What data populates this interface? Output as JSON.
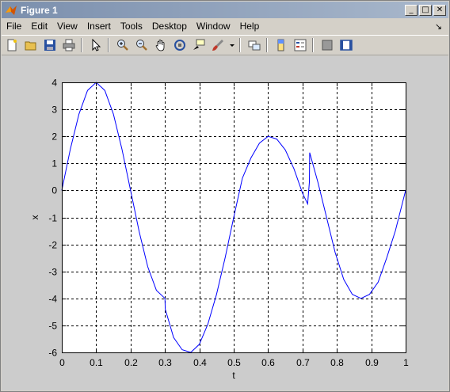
{
  "window": {
    "title": "Figure 1",
    "buttons": {
      "minimize": "_",
      "maximize": "□",
      "close": "✕"
    }
  },
  "menu": {
    "items": [
      "File",
      "Edit",
      "View",
      "Insert",
      "Tools",
      "Desktop",
      "Window",
      "Help"
    ],
    "dock_arrow": "↘"
  },
  "toolbar": {
    "icons": [
      "new-figure-icon",
      "open-file-icon",
      "save-icon",
      "print-icon",
      "arrow-pointer-icon",
      "zoom-in-icon",
      "zoom-out-icon",
      "pan-hand-icon",
      "rotate-3d-icon",
      "data-cursor-icon",
      "brush-icon",
      "link-plot-icon",
      "colorbar-icon",
      "legend-icon",
      "hide-plot-tools-icon",
      "show-plot-tools-icon"
    ]
  },
  "colors": {
    "line": "#0000ff",
    "figure_bg": "#cccccc",
    "axes_bg": "#ffffff"
  },
  "chart_data": {
    "type": "line",
    "title": "",
    "xlabel": "t",
    "ylabel": "x",
    "xlim": [
      0,
      1
    ],
    "ylim": [
      -6,
      4
    ],
    "grid": true,
    "grid_style": "dashed",
    "xticks": [
      0,
      0.1,
      0.2,
      0.3,
      0.4,
      0.5,
      0.6,
      0.7,
      0.8,
      0.9,
      1
    ],
    "xtick_labels": [
      "0",
      "0.1",
      "0.2",
      "0.3",
      "0.4",
      "0.5",
      "0.6",
      "0.7",
      "0.8",
      "0.9",
      "1"
    ],
    "yticks": [
      -6,
      -5,
      -4,
      -3,
      -2,
      -1,
      0,
      1,
      2,
      3,
      4
    ],
    "ytick_labels": [
      "-6",
      "-5",
      "-4",
      "-3",
      "-2",
      "-1",
      "0",
      "1",
      "2",
      "3",
      "4"
    ],
    "series": [
      {
        "color": "#0000ff",
        "x": [
          0,
          0.025,
          0.05,
          0.075,
          0.1,
          0.125,
          0.15,
          0.175,
          0.2,
          0.225,
          0.25,
          0.275,
          0.3,
          0.301,
          0.325,
          0.35,
          0.375,
          0.4,
          0.425,
          0.45,
          0.475,
          0.5,
          0.525,
          0.55,
          0.575,
          0.6,
          0.625,
          0.65,
          0.675,
          0.7,
          0.715,
          0.72,
          0.721,
          0.745,
          0.77,
          0.795,
          0.82,
          0.845,
          0.87,
          0.895,
          0.92,
          0.945,
          0.97,
          1
        ],
        "y": [
          0,
          1.53,
          2.83,
          3.7,
          4.0,
          3.7,
          2.83,
          1.53,
          0,
          -1.53,
          -2.83,
          -3.7,
          -4.0,
          -4.4,
          -5.45,
          -5.9,
          -6.0,
          -5.7,
          -4.95,
          -3.85,
          -2.5,
          -1.0,
          0.45,
          1.2,
          1.75,
          2.0,
          1.9,
          1.5,
          0.8,
          -0.1,
          -0.5,
          0.3,
          1.4,
          0.3,
          -1.0,
          -2.3,
          -3.3,
          -3.85,
          -4.0,
          -3.85,
          -3.4,
          -2.5,
          -1.5,
          0
        ]
      }
    ]
  }
}
